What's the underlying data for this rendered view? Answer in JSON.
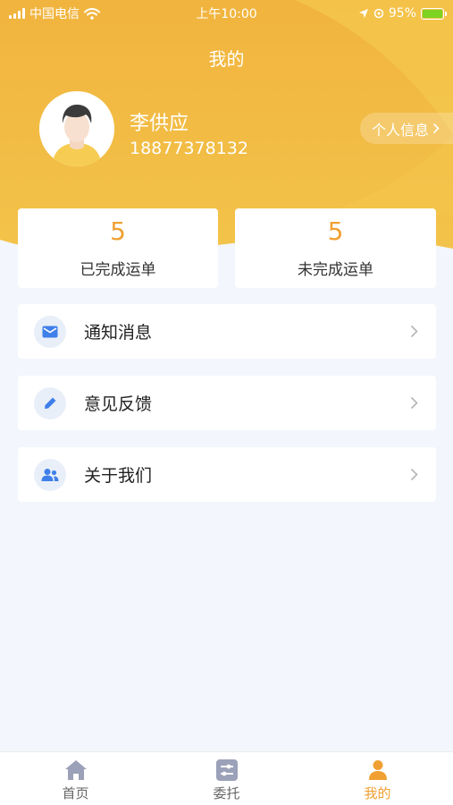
{
  "status_bar": {
    "carrier": "中国电信",
    "time": "上午10:00",
    "battery": "95%"
  },
  "header": {
    "title": "我的"
  },
  "user": {
    "name": "李供应",
    "phone": "18877378132",
    "profile_link": "个人信息"
  },
  "stats": [
    {
      "value": "5",
      "label": "已完成运单"
    },
    {
      "value": "5",
      "label": "未完成运单"
    }
  ],
  "menu": [
    {
      "label": "通知消息",
      "icon": "mail-icon"
    },
    {
      "label": "意见反馈",
      "icon": "pencil-icon"
    },
    {
      "label": "关于我们",
      "icon": "users-icon"
    }
  ],
  "tabbar": [
    {
      "label": "首页",
      "icon": "home-icon",
      "active": false
    },
    {
      "label": "委托",
      "icon": "sliders-icon",
      "active": false
    },
    {
      "label": "我的",
      "icon": "person-icon",
      "active": true
    }
  ],
  "colors": {
    "accent": "#f0a032",
    "header_top": "#f1b43e",
    "header_bottom": "#f4c94a",
    "icon_blue": "#3f7fe9",
    "background": "#f3f6fc"
  }
}
